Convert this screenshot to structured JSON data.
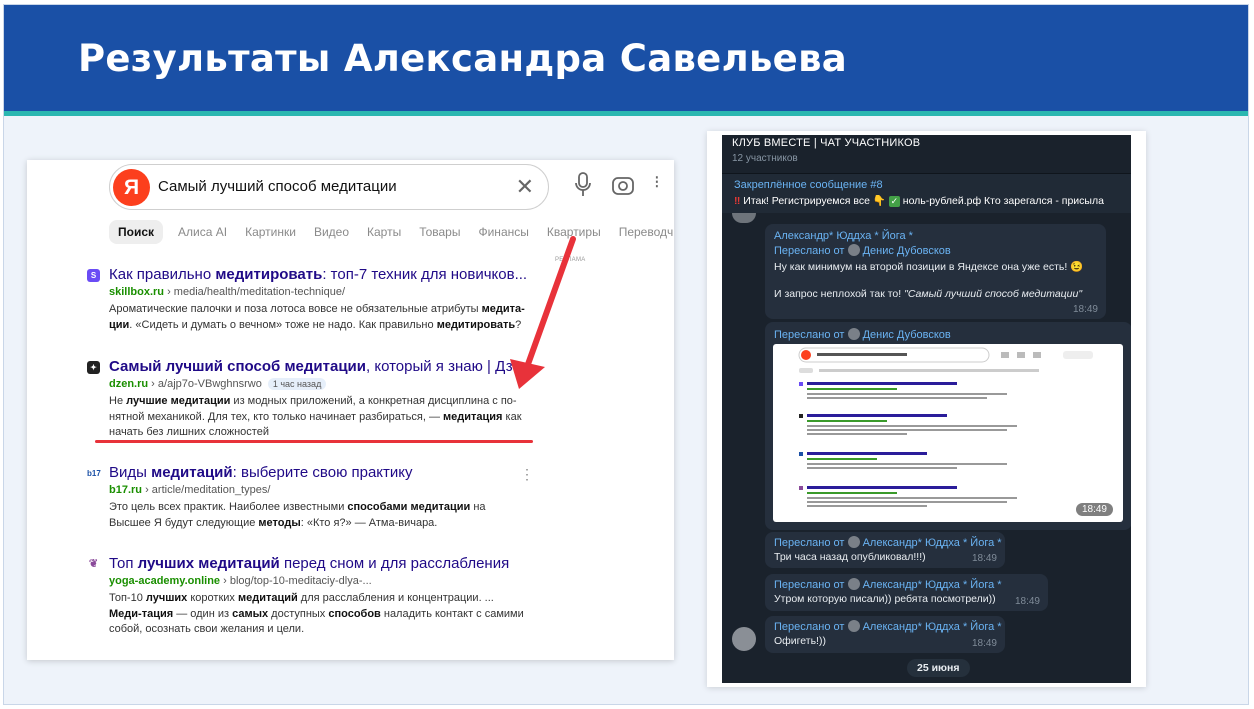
{
  "slide": {
    "title": "Результаты Александра Савельева",
    "colors": {
      "header": "#1a50a6",
      "strip": "#2ab7b0",
      "highlight_line": "#e8323a"
    }
  },
  "yandex": {
    "logo_letter": "Я",
    "query": "Самый лучший способ медитации",
    "tabs": [
      "Поиск",
      "Алиса AI",
      "Картинки",
      "Видео",
      "Карты",
      "Товары",
      "Финансы",
      "Квартиры",
      "Переводчик"
    ],
    "ad_label": "РЕКЛАМА",
    "results": [
      {
        "icon": "S",
        "title_plain_1": "Как правильно ",
        "title_bold": "медитировать",
        "title_plain_2": ": топ-7 техник для новичков...",
        "domain": "skillbox.ru",
        "path": " › media/health/meditation-technique/",
        "badge": "",
        "snippet_html": "Ароматические палочки и поза лотоса вовсе не обязательные атрибуты <b>медита-ции</b>. «Сидеть и думать о вечном» тоже не надо. Как правильно <b>медитировать</b>?"
      },
      {
        "icon": "✦",
        "title_plain_1": "",
        "title_bold": "Самый лучший способ медитации",
        "title_plain_2": ", который я знаю | Дзен",
        "domain": "dzen.ru",
        "path": " › a/ajp7o-VBwghnsrwo",
        "badge": "1 час назад",
        "snippet_html": "Не <b>лучшие медитации</b> из модных приложений, а конкретная дисциплина с по-нятной механикой. Для тех, кто только начинает разбираться, — <b>медитация</b> как начать без лишних сложностей"
      },
      {
        "icon": "b17",
        "title_plain_1": "Виды ",
        "title_bold": "медитаций",
        "title_plain_2": ": выберите свою практику",
        "domain": "b17.ru",
        "path": " › article/meditation_types/",
        "badge": "",
        "snippet_html": "Это цель всех практик. Наиболее известными <b>способами медитации</b> на Высшее Я будут следующие <b>методы</b>: «Кто я?» — Атма-вичара."
      },
      {
        "icon": "❦",
        "title_plain_1": "Топ ",
        "title_bold": "лучших медитаций",
        "title_plain_2": " перед сном и для расслабления",
        "domain": "yoga-academy.online",
        "path": " › blog/top-10-meditaciy-dlya-...",
        "badge": "",
        "snippet_html": "Топ-10 <b>лучших</b> коротких <b>медитаций</b> для расслабления и концентрации. ... <b>Меди-тация</b> — один из <b>самых</b> доступных <b>способов</b> наладить контакт с самими собой, осознать свои желания и цели."
      }
    ]
  },
  "telegram": {
    "chat_name": "КЛУБ ВМЕСТЕ | ЧАТ УЧАСТНИКОВ",
    "members": "12 участников",
    "pinned_title": "Закреплённое сообщение #8",
    "pinned_text_1": "Итак! Регистрируемся все 👇",
    "pinned_text_2": "ноль-рублей.рф  Кто зарегался - присыла",
    "msg1": {
      "author": "Александр* Юддха * Йога *",
      "forward_prefix": "Переслано от ",
      "forward_from": "Денис Дубовсков",
      "line1": "Ну как минимум на второй позиции в Яндексе она уже есть! 😉",
      "line2_plain": "И запрос неплохой так то! ",
      "line2_italic": "\"Самый лучший способ медитации\"",
      "time": "18:49"
    },
    "msg2": {
      "forward_prefix": "Переслано от ",
      "forward_from": "Денис Дубовсков",
      "time": "18:49"
    },
    "msg3": {
      "forward_prefix": "Переслано от ",
      "forward_from": "Александр* Юддха * Йога *",
      "text": "Три часа назад опубликовал!!!)",
      "time": "18:49"
    },
    "msg4": {
      "forward_prefix": "Переслано от ",
      "forward_from": "Александр* Юддха * Йога *",
      "text": "Утром которую писали)) ребята посмотрели))",
      "time": "18:49"
    },
    "msg5": {
      "forward_prefix": "Переслано от ",
      "forward_from": "Александр* Юддха * Йога *",
      "text": "Офигеть!))",
      "time": "18:49"
    },
    "date": "25 июня"
  }
}
